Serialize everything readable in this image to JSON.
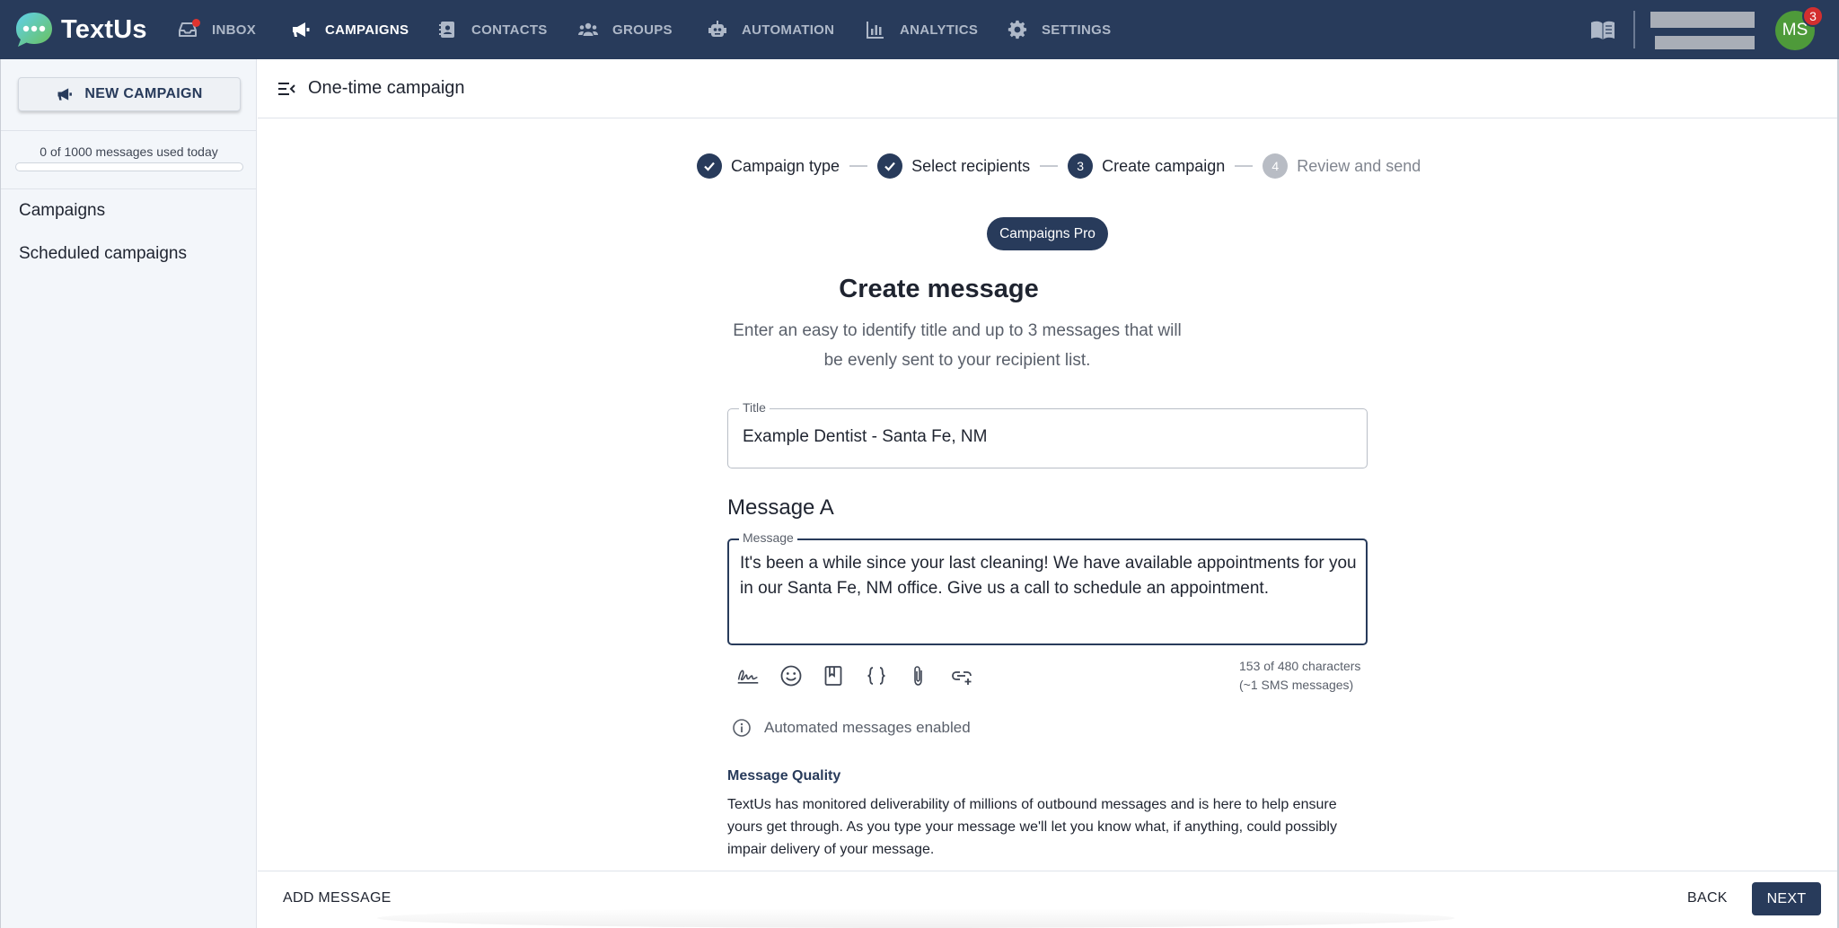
{
  "app": {
    "name": "TextUs"
  },
  "nav": {
    "items": [
      {
        "label": "INBOX",
        "icon": "inbox-icon"
      },
      {
        "label": "CAMPAIGNS",
        "icon": "megaphone-icon",
        "active": true
      },
      {
        "label": "CONTACTS",
        "icon": "contact-card-icon"
      },
      {
        "label": "GROUPS",
        "icon": "people-icon"
      },
      {
        "label": "AUTOMATION",
        "icon": "robot-icon"
      },
      {
        "label": "ANALYTICS",
        "icon": "bar-chart-icon"
      },
      {
        "label": "SETTINGS",
        "icon": "gear-icon"
      }
    ],
    "user_initials": "MS",
    "notification_count": "3"
  },
  "sidebar": {
    "new_campaign_label": "NEW CAMPAIGN",
    "usage_text": "0 of 1000 messages used today",
    "usage_fraction": 0,
    "links": [
      {
        "label": "Campaigns"
      },
      {
        "label": "Scheduled campaigns"
      }
    ]
  },
  "header": {
    "title": "One-time campaign"
  },
  "stepper": {
    "steps": [
      {
        "number": "1",
        "label": "Campaign type",
        "state": "done"
      },
      {
        "number": "2",
        "label": "Select recipients",
        "state": "done"
      },
      {
        "number": "3",
        "label": "Create campaign",
        "state": "current"
      },
      {
        "number": "4",
        "label": "Review and send",
        "state": "todo"
      }
    ]
  },
  "form": {
    "badge": "Campaigns Pro",
    "heading": "Create message",
    "intro": "Enter an easy to identify title and up to 3 messages that will be evenly sent to your recipient list.",
    "title_label": "Title",
    "title_value": "Example Dentist - Santa Fe, NM",
    "message_heading": "Message A",
    "message_label": "Message",
    "message_value": "It's been a while since your last cleaning! We have available appointments for you in our Santa Fe, NM office. Give us a call to schedule an appointment.",
    "char_count_line1": "153 of 480 characters",
    "char_count_line2": "(~1 SMS messages)",
    "automated_info": "Automated messages enabled",
    "quality_heading": "Message Quality",
    "quality_text": "TextUs has monitored deliverability of millions of outbound messages and is here to help ensure yours get through. As you type your message we'll let you know what, if anything, could possibly impair delivery of your message."
  },
  "footer": {
    "add_message": "ADD MESSAGE",
    "back": "BACK",
    "next": "NEXT"
  }
}
